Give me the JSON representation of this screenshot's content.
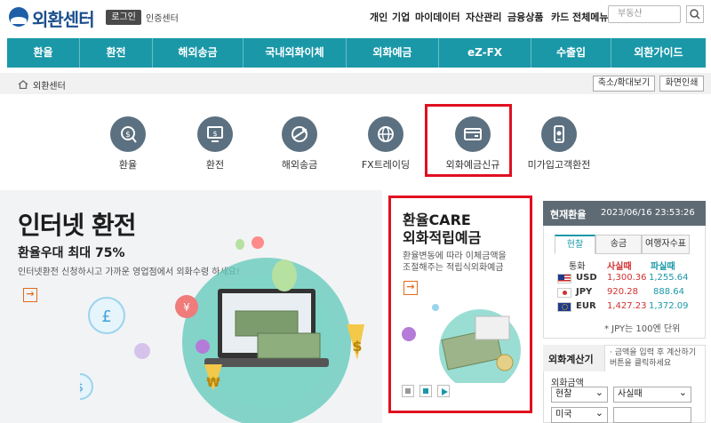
{
  "header": {
    "logo_text": "외환센터",
    "login_label": "로그인",
    "cert_label": "인증센터",
    "top_menu": [
      "개인",
      "기업",
      "마이데이터",
      "자산관리",
      "금융상품",
      "카드",
      "전체메뉴"
    ],
    "search_placeholder": "부동산"
  },
  "nav": {
    "items": [
      "환율",
      "환전",
      "해외송금",
      "국내외화이체",
      "외화예금",
      "eZ-FX",
      "수출입",
      "외환가이드"
    ]
  },
  "breadcrumb": {
    "label": "외환센터",
    "zoom_label": "축소/확대보기",
    "print_label": "화면인쇄"
  },
  "quick_menu": [
    {
      "label": "환율",
      "icon": "exchange-rate-icon"
    },
    {
      "label": "환전",
      "icon": "money-exchange-icon"
    },
    {
      "label": "해외송금",
      "icon": "globe-plane-icon"
    },
    {
      "label": "FX트레이딩",
      "icon": "globe-icon"
    },
    {
      "label": "외화예금신규",
      "icon": "card-wallet-icon"
    },
    {
      "label": "미가입고객환전",
      "icon": "mobile-icon"
    }
  ],
  "banner_left": {
    "title": "인터넷 환전",
    "subtitle": "환율우대 최대 75%",
    "description": "인터넷환전 신청하시고 가까운 영업점에서 외화수령 하세요!"
  },
  "banner_mid": {
    "title_line1": "환율CARE",
    "title_line2": "외화적립예금",
    "desc_line1": "환율변동에 따라 이체금액을",
    "desc_line2": "조절해주는 적립식외화예금"
  },
  "rates": {
    "title": "현재환율",
    "datetime": "2023/06/16 23:53:26",
    "tabs": [
      "현찰",
      "송금",
      "여행자수표"
    ],
    "col_currency": "통화",
    "col_buy": "사실때",
    "col_sell": "파실때",
    "rows": [
      {
        "code": "USD",
        "buy": "1,300.36",
        "sell": "1,255.64"
      },
      {
        "code": "JPY",
        "buy": "920.28",
        "sell": "888.64"
      },
      {
        "code": "EUR",
        "buy": "1,427.23",
        "sell": "1,372.09"
      }
    ],
    "note": "* JPY는 100엔 단위",
    "colors": {
      "buy": "#d32f2f",
      "sell": "#1a98a8"
    }
  },
  "calculator": {
    "title": "외화계산기",
    "note_line1": "· 금액을 입력 후 계산하기",
    "note_line2": "버튼을 클릭하세요",
    "amount_label": "외화금액",
    "type_select": "현찰",
    "mode_select": "사실때",
    "currency_select": "미국"
  }
}
